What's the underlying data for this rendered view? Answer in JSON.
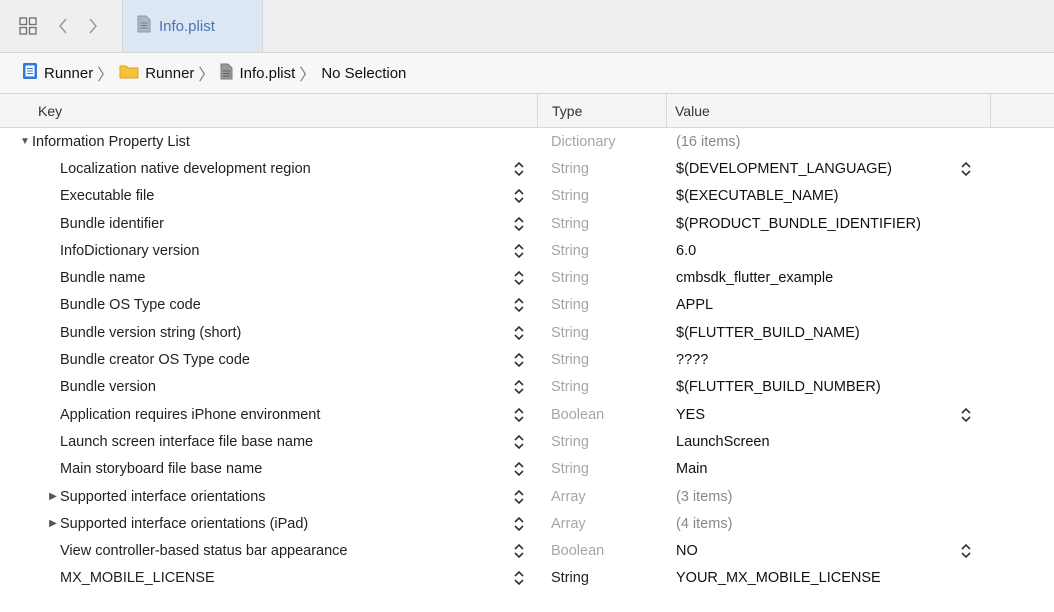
{
  "tab": {
    "label": "Info.plist"
  },
  "breadcrumb": [
    {
      "label": "Runner",
      "icon": "project-icon"
    },
    {
      "label": "Runner",
      "icon": "folder-icon"
    },
    {
      "label": "Info.plist",
      "icon": "file-icon"
    },
    {
      "label": "No Selection",
      "icon": ""
    }
  ],
  "columns": {
    "key": "Key",
    "type": "Type",
    "value": "Value"
  },
  "root": {
    "key": "Information Property List",
    "type": "Dictionary",
    "value": "(16 items)"
  },
  "rows": [
    {
      "key": "Localization native development region",
      "type": "String",
      "value": "$(DEVELOPMENT_LANGUAGE)"
    },
    {
      "key": "Executable file",
      "type": "String",
      "value": "$(EXECUTABLE_NAME)"
    },
    {
      "key": "Bundle identifier",
      "type": "String",
      "value": "$(PRODUCT_BUNDLE_IDENTIFIER)"
    },
    {
      "key": "InfoDictionary version",
      "type": "String",
      "value": "6.0"
    },
    {
      "key": "Bundle name",
      "type": "String",
      "value": "cmbsdk_flutter_example"
    },
    {
      "key": "Bundle OS Type code",
      "type": "String",
      "value": "APPL"
    },
    {
      "key": "Bundle version string (short)",
      "type": "String",
      "value": "$(FLUTTER_BUILD_NAME)"
    },
    {
      "key": "Bundle creator OS Type code",
      "type": "String",
      "value": "????"
    },
    {
      "key": "Bundle version",
      "type": "String",
      "value": "$(FLUTTER_BUILD_NUMBER)"
    },
    {
      "key": "Application requires iPhone environment",
      "type": "Boolean",
      "value": "YES"
    },
    {
      "key": "Launch screen interface file base name",
      "type": "String",
      "value": "LaunchScreen"
    },
    {
      "key": "Main storyboard file base name",
      "type": "String",
      "value": "Main"
    },
    {
      "key": "Supported interface orientations",
      "type": "Array",
      "value": "(3 items)"
    },
    {
      "key": "Supported interface orientations (iPad)",
      "type": "Array",
      "value": "(4 items)"
    },
    {
      "key": "View controller-based status bar appearance",
      "type": "Boolean",
      "value": "NO"
    },
    {
      "key": "MX_MOBILE_LICENSE",
      "type": "String",
      "value": "YOUR_MX_MOBILE_LICENSE"
    }
  ]
}
